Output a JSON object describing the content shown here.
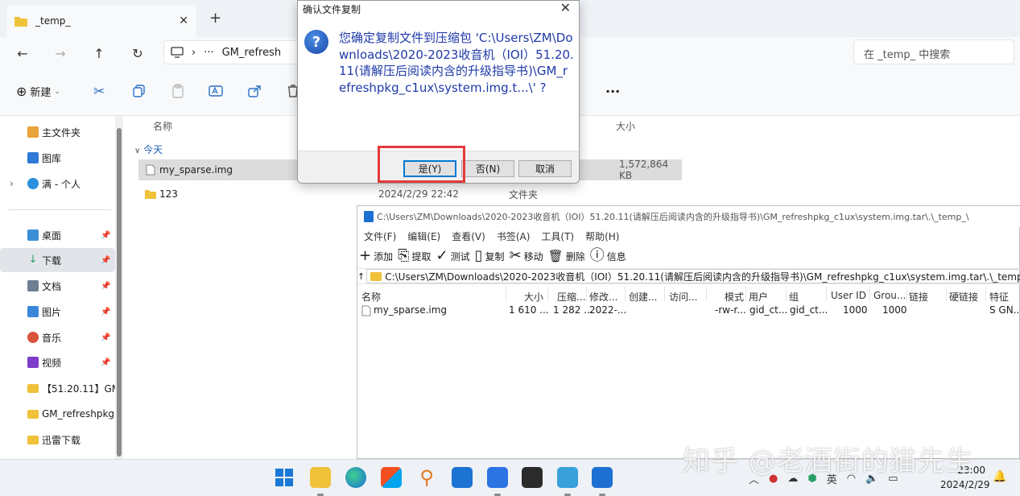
{
  "explorer": {
    "tab_label": "_temp_",
    "tab_close": "✕",
    "new_tab": "+",
    "address_more": "···",
    "address_segment": "GM_refresh",
    "search_placeholder": "在 _temp_ 中搜索",
    "toolbar": {
      "new_label": "新建",
      "more": "···"
    },
    "columns": {
      "name": "名称",
      "size": "大小"
    },
    "group": "今天",
    "files": [
      {
        "name": "my_sparse.img",
        "date": "",
        "type": "",
        "size": "1,572,864 KB",
        "kind": "file",
        "selected": true
      },
      {
        "name": "123",
        "date": "2024/2/29 22:42",
        "type": "文件夹",
        "size": "",
        "kind": "folder",
        "selected": false
      }
    ],
    "nav": [
      {
        "label": "主文件夹",
        "icon": "home-icon",
        "color": "#e8a33a"
      },
      {
        "label": "图库",
        "icon": "gallery-icon",
        "color": "#2f7ad6"
      },
      {
        "label": "满 - 个人",
        "icon": "onedrive-icon",
        "color": "#2a8fdc"
      },
      {
        "label": "桌面",
        "icon": "desktop-icon",
        "color": "#3a8fd6"
      },
      {
        "label": "下载",
        "icon": "download-icon",
        "color": "#2aa06a"
      },
      {
        "label": "文档",
        "icon": "documents-icon",
        "color": "#6d7f92"
      },
      {
        "label": "图片",
        "icon": "pictures-icon",
        "color": "#3b87d9"
      },
      {
        "label": "音乐",
        "icon": "music-icon",
        "color": "#d9533b"
      },
      {
        "label": "视频",
        "icon": "videos-icon",
        "color": "#7d3cc9"
      },
      {
        "label": "【51.20.11】GM",
        "icon": "folder-icon",
        "color": "#f0c23a"
      },
      {
        "label": "GM_refreshpkg",
        "icon": "folder-icon",
        "color": "#f0c23a"
      },
      {
        "label": "迅雷下载",
        "icon": "folder-icon",
        "color": "#f0c23a"
      }
    ]
  },
  "zip": {
    "title": "C:\\Users\\ZM\\Downloads\\2020-2023收音机（IOI）51.20.11(请解压后阅读内含的升级指导书)\\GM_refreshpkg_c1ux\\system.img.tar\\.\\_temp_\\",
    "menu": [
      "文件(F)",
      "编辑(E)",
      "查看(V)",
      "书签(A)",
      "工具(T)",
      "帮助(H)"
    ],
    "tools": [
      {
        "label": "添加",
        "glyph": "+"
      },
      {
        "label": "提取",
        "glyph": "⎘"
      },
      {
        "label": "测试",
        "glyph": "✓"
      },
      {
        "label": "复制",
        "glyph": "▯"
      },
      {
        "label": "移动",
        "glyph": "✂"
      },
      {
        "label": "删除",
        "glyph": "🗑"
      },
      {
        "label": "信息",
        "glyph": "ⓘ"
      }
    ],
    "up": "↑",
    "path": "C:\\Users\\ZM\\Downloads\\2020-2023收音机（IOI）51.20.11(请解压后阅读内含的升级指导书)\\GM_refreshpkg_c1ux\\system.img.tar\\.\\_temp_\\",
    "headers": {
      "name": "名称",
      "size": "大小",
      "packed": "压缩...",
      "modified": "修改...",
      "created": "创建...",
      "accessed": "访问...",
      "mode": "模式",
      "user": "用户",
      "group": "组",
      "user_id": "User ID",
      "group_id": "Grou...",
      "link": "链接",
      "hardlink": "硬链接",
      "attr": "特征"
    },
    "row": {
      "name": "my_sparse.img",
      "size": "1 610 ...",
      "packed": "1 282 ...",
      "modified": "2022-...",
      "mode": "-rw-r...",
      "user": "gid_ct...",
      "group": "gid_ct...",
      "user_id": "1000",
      "group_id": "1000",
      "attr": "S GN..."
    }
  },
  "dialog": {
    "title": "确认文件复制",
    "close": "✕",
    "icon": "?",
    "message": "您确定复制文件到压缩包 'C:\\Users\\ZM\\Downloads\\2020-2023收音机（IOI）51.20.11(请解压后阅读内含的升级指导书)\\GM_refreshpkg_c1ux\\system.img.t...\\' ?",
    "yes": "是(Y)",
    "no": "否(N)",
    "cancel": "取消"
  },
  "tray": {
    "chevron": "︿",
    "ime": "英",
    "time": "23:00",
    "date": "2024/2/29"
  },
  "watermark": "知乎 @老酒街的猫先生"
}
